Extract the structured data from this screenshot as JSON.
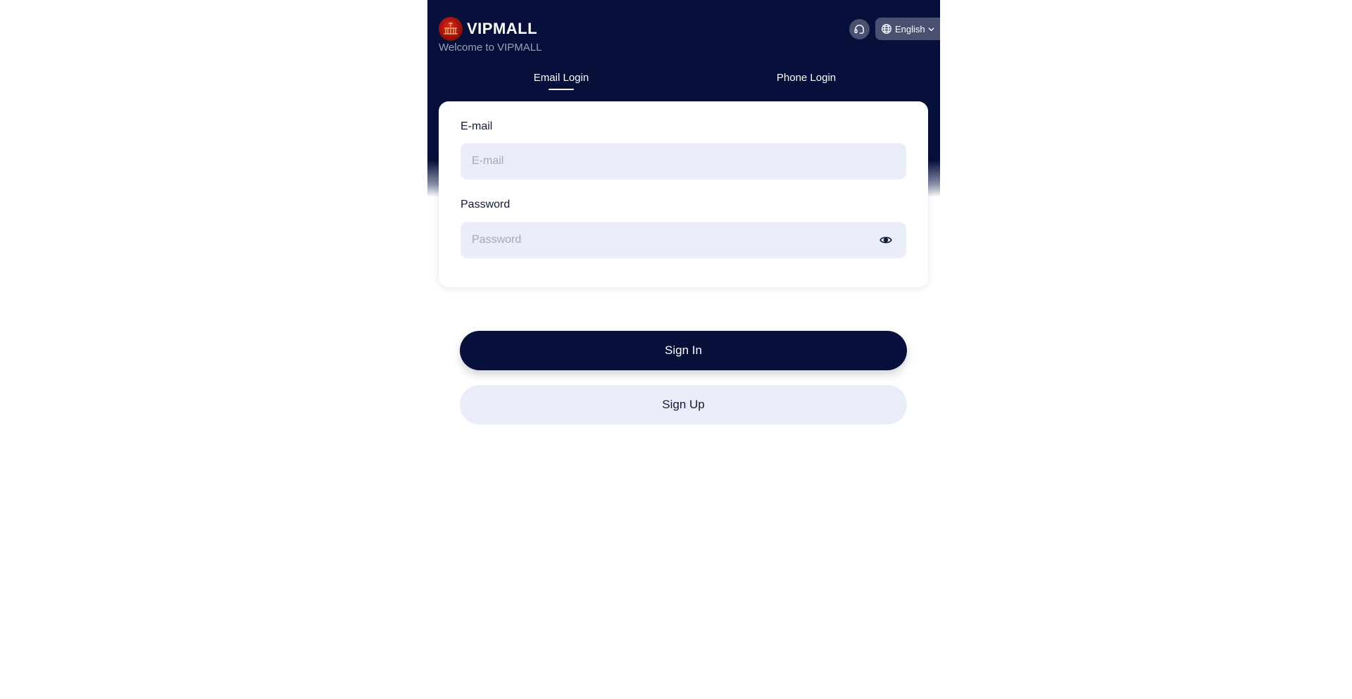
{
  "brand": {
    "name": "VIPMALL",
    "welcome": "Welcome to VIPMALL",
    "logo_icon": "logo-emblem"
  },
  "header": {
    "support_icon": "headset-icon",
    "language": {
      "icon": "globe-icon",
      "label": "English",
      "chevron": "chevron-down-icon"
    }
  },
  "tabs": [
    {
      "label": "Email Login",
      "active": true
    },
    {
      "label": "Phone Login",
      "active": false
    }
  ],
  "form": {
    "email": {
      "label": "E-mail",
      "placeholder": "E-mail",
      "value": ""
    },
    "password": {
      "label": "Password",
      "placeholder": "Password",
      "value": "",
      "toggle_icon": "eye-icon"
    }
  },
  "actions": {
    "sign_in": "Sign In",
    "sign_up": "Sign Up"
  },
  "colors": {
    "primary": "#06103a",
    "input_bg": "#e9edfa",
    "chip_bg": "#4a5170",
    "muted_text": "#9aa0b8"
  }
}
